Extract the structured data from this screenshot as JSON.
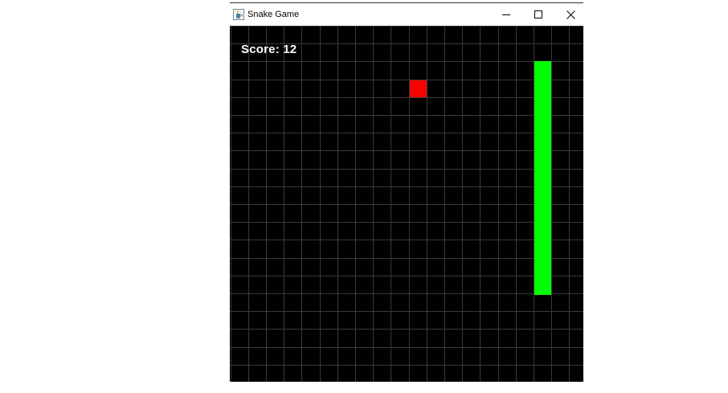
{
  "window": {
    "title": "Snake Game",
    "buttons": [
      "minimize",
      "maximize",
      "close"
    ]
  },
  "game": {
    "score_label": "Score: 12",
    "grid": {
      "columns": 20,
      "rows": 20,
      "line_color": "#3a3a3a"
    },
    "background_color": "#000000",
    "food": {
      "col": 10,
      "row": 3,
      "color": "#ff0000"
    },
    "snake": {
      "color": "#00ff00",
      "segments": [
        {
          "col": 17,
          "row": 2
        },
        {
          "col": 17,
          "row": 3
        },
        {
          "col": 17,
          "row": 4
        },
        {
          "col": 17,
          "row": 5
        },
        {
          "col": 17,
          "row": 6
        },
        {
          "col": 17,
          "row": 7
        },
        {
          "col": 17,
          "row": 8
        },
        {
          "col": 17,
          "row": 9
        },
        {
          "col": 17,
          "row": 10
        },
        {
          "col": 17,
          "row": 11
        },
        {
          "col": 17,
          "row": 12
        },
        {
          "col": 17,
          "row": 13
        },
        {
          "col": 17,
          "row": 14
        }
      ]
    }
  },
  "icons": {
    "app": "java-cup-icon",
    "minimize": "minimize-icon",
    "maximize": "maximize-icon",
    "close": "close-icon"
  }
}
